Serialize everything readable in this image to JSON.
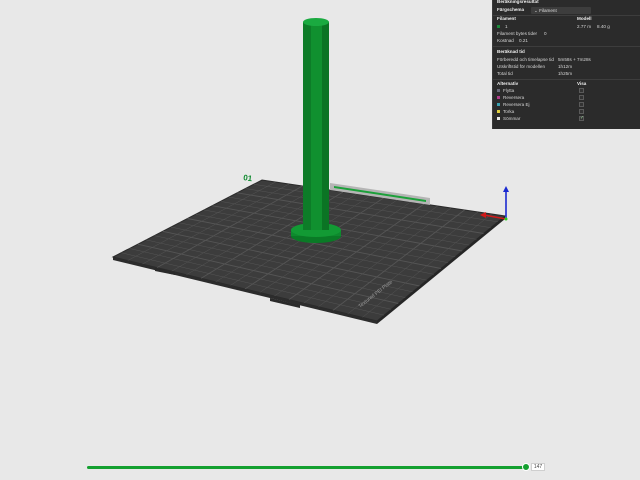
{
  "panel": {
    "title": "Beräkningsresultat",
    "color_scheme_label": "Färgschema",
    "color_scheme_value": "Filament",
    "filament_header": "Filament",
    "model_header": "Modell",
    "filament_index": "1",
    "filament_length": "2.77 m",
    "filament_weight": "8.40 g",
    "filament_changes_label": "Filament bytes tider",
    "filament_changes_value": "0",
    "cost_label": "Kostnad",
    "cost_value": "0.21",
    "time_section": "Beräknad tid",
    "prepare_label": "Förberedd och timelapse tid",
    "prepare_value": "5m58s + 7m28s",
    "model_print_label": "Utskriftstid för modellen",
    "model_print_value": "1h12m",
    "total_label": "Total tid",
    "total_value": "1h25m",
    "options_header": "Alternativ",
    "show_header": "Visa",
    "options": [
      {
        "label": "Flytta",
        "color": "#6a6a7a",
        "checked": false
      },
      {
        "label": "Reversera",
        "color": "#b03b8a",
        "checked": false
      },
      {
        "label": "Reversera Ej",
        "color": "#3aa0b0",
        "checked": false
      },
      {
        "label": "Torka",
        "color": "#e0d040",
        "checked": false
      },
      {
        "label": "Sömmar",
        "color": "#e8e8e8",
        "checked": true
      }
    ],
    "filament_color": "#1a8a3a"
  },
  "viewport": {
    "plate_label_num": "01",
    "plate_brand_text": "Textured PEI Plate",
    "model_color": "#0e8a2e",
    "plate_color": "#3c3c3c"
  },
  "slider": {
    "value": "147",
    "fraction": 0.99
  }
}
